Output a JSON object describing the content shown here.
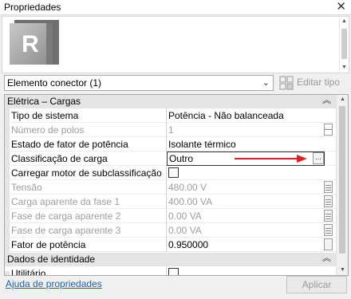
{
  "window": {
    "title": "Propriedades",
    "close_glyph": "✕"
  },
  "preview": {
    "logo_letter": "R"
  },
  "type_selector": {
    "value": "Elemento conector (1)"
  },
  "edit_type": {
    "label": "Editar tipo"
  },
  "categories": [
    {
      "label": "Elétrica – Cargas"
    },
    {
      "label": "Dados de identidade"
    }
  ],
  "rows": [
    {
      "name": "Tipo de sistema",
      "value": "Potência - Não balanceada"
    },
    {
      "name": "Número de polos",
      "value": "1"
    },
    {
      "name": "Estado de fator de potência",
      "value": "Isolante térmico"
    },
    {
      "name": "Classificação de carga",
      "value": "Outro",
      "button": "..."
    },
    {
      "name": "Carregar motor de subclassificação",
      "value": "",
      "checked": false
    },
    {
      "name": "Tensão",
      "value": "480.00 V"
    },
    {
      "name": "Carga aparente da fase 1",
      "value": "400.00 VA"
    },
    {
      "name": "Fase de carga aparente 2",
      "value": "0.00 VA"
    },
    {
      "name": "Fase de carga aparente 3",
      "value": "0.00 VA"
    },
    {
      "name": "Fator de potência",
      "value": "0.950000"
    },
    {
      "name": "Utilitário",
      "value": "",
      "checked": false
    }
  ],
  "footer": {
    "help_link": "Ajuda de propriedades",
    "apply_label": "Aplicar"
  },
  "colors": {
    "annotation_arrow": "#e02020",
    "link": "#1a62b8"
  }
}
